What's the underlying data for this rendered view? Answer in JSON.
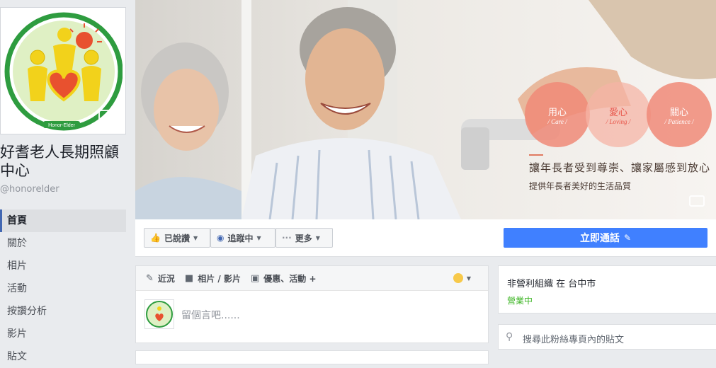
{
  "page": {
    "name": "好耆老人長期照顧中心",
    "handle": "@honorelder",
    "logo_caption": "Honor-Elder"
  },
  "nav": {
    "items": [
      {
        "label": "首頁",
        "active": true
      },
      {
        "label": "關於"
      },
      {
        "label": "相片"
      },
      {
        "label": "活動"
      },
      {
        "label": "按讚分析"
      },
      {
        "label": "影片"
      },
      {
        "label": "貼文"
      }
    ]
  },
  "cover": {
    "circles": [
      {
        "zh": "用心",
        "en": "/ Care /"
      },
      {
        "zh": "愛心",
        "en": "/ Loving /"
      },
      {
        "zh": "關心",
        "en": "/ Patience /"
      }
    ],
    "slogan": "讓年長者受到尊崇、讓家屬感到放心",
    "subslogan": "提供年長者美好的生活品質"
  },
  "actions": {
    "liked": "已說讚",
    "following": "追蹤中",
    "more": "更多",
    "cta": "立即通話"
  },
  "composer": {
    "tabs": [
      "近況",
      "相片 / 影片",
      "優惠、活動 +"
    ],
    "placeholder": "留個言吧......"
  },
  "info": {
    "type": "非營利組織 在 台中市",
    "status": "營業中"
  },
  "search": {
    "placeholder": "搜尋此粉絲專頁內的貼文"
  },
  "colors": {
    "facebook_blue": "#4267b2",
    "cta_blue": "#4080ff",
    "open_green": "#42b72a",
    "circle_peach": "#f08a78"
  }
}
